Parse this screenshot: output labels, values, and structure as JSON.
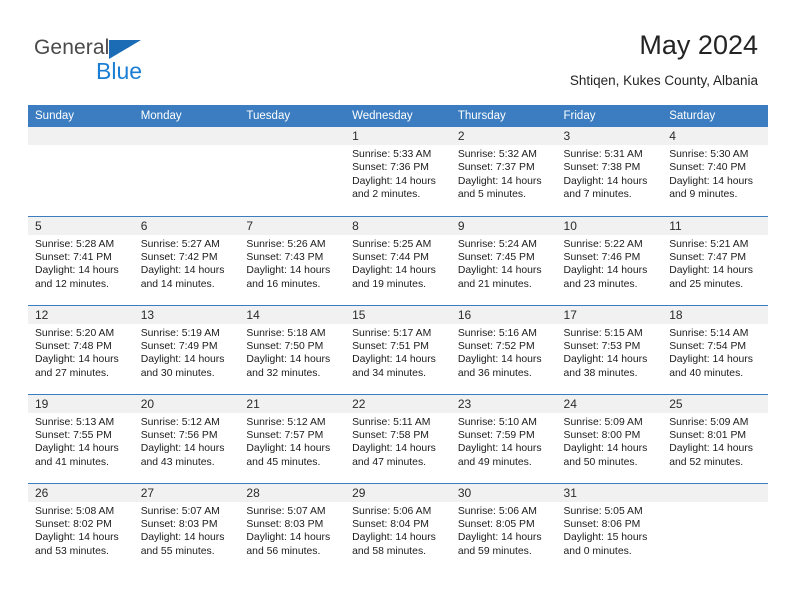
{
  "logo": {
    "word_top": "General",
    "word_bottom": "Blue",
    "color_dark": "#4a4a4a",
    "color_blue": "#1a7fd4",
    "triangle_color": "#1c6cb5"
  },
  "header": {
    "title": "May 2024",
    "subtitle": "Shtiqen, Kukes County, Albania",
    "accent_color": "#3b7dc0"
  },
  "calendar": {
    "weekdays": [
      "Sunday",
      "Monday",
      "Tuesday",
      "Wednesday",
      "Thursday",
      "Friday",
      "Saturday"
    ],
    "weeks": [
      [
        {
          "day": "",
          "empty": true
        },
        {
          "day": "",
          "empty": true
        },
        {
          "day": "",
          "empty": true
        },
        {
          "day": "1",
          "sunrise": "Sunrise: 5:33 AM",
          "sunset": "Sunset: 7:36 PM",
          "daylight_1": "Daylight: 14 hours",
          "daylight_2": "and 2 minutes."
        },
        {
          "day": "2",
          "sunrise": "Sunrise: 5:32 AM",
          "sunset": "Sunset: 7:37 PM",
          "daylight_1": "Daylight: 14 hours",
          "daylight_2": "and 5 minutes."
        },
        {
          "day": "3",
          "sunrise": "Sunrise: 5:31 AM",
          "sunset": "Sunset: 7:38 PM",
          "daylight_1": "Daylight: 14 hours",
          "daylight_2": "and 7 minutes."
        },
        {
          "day": "4",
          "sunrise": "Sunrise: 5:30 AM",
          "sunset": "Sunset: 7:40 PM",
          "daylight_1": "Daylight: 14 hours",
          "daylight_2": "and 9 minutes."
        }
      ],
      [
        {
          "day": "5",
          "sunrise": "Sunrise: 5:28 AM",
          "sunset": "Sunset: 7:41 PM",
          "daylight_1": "Daylight: 14 hours",
          "daylight_2": "and 12 minutes."
        },
        {
          "day": "6",
          "sunrise": "Sunrise: 5:27 AM",
          "sunset": "Sunset: 7:42 PM",
          "daylight_1": "Daylight: 14 hours",
          "daylight_2": "and 14 minutes."
        },
        {
          "day": "7",
          "sunrise": "Sunrise: 5:26 AM",
          "sunset": "Sunset: 7:43 PM",
          "daylight_1": "Daylight: 14 hours",
          "daylight_2": "and 16 minutes."
        },
        {
          "day": "8",
          "sunrise": "Sunrise: 5:25 AM",
          "sunset": "Sunset: 7:44 PM",
          "daylight_1": "Daylight: 14 hours",
          "daylight_2": "and 19 minutes."
        },
        {
          "day": "9",
          "sunrise": "Sunrise: 5:24 AM",
          "sunset": "Sunset: 7:45 PM",
          "daylight_1": "Daylight: 14 hours",
          "daylight_2": "and 21 minutes."
        },
        {
          "day": "10",
          "sunrise": "Sunrise: 5:22 AM",
          "sunset": "Sunset: 7:46 PM",
          "daylight_1": "Daylight: 14 hours",
          "daylight_2": "and 23 minutes."
        },
        {
          "day": "11",
          "sunrise": "Sunrise: 5:21 AM",
          "sunset": "Sunset: 7:47 PM",
          "daylight_1": "Daylight: 14 hours",
          "daylight_2": "and 25 minutes."
        }
      ],
      [
        {
          "day": "12",
          "sunrise": "Sunrise: 5:20 AM",
          "sunset": "Sunset: 7:48 PM",
          "daylight_1": "Daylight: 14 hours",
          "daylight_2": "and 27 minutes."
        },
        {
          "day": "13",
          "sunrise": "Sunrise: 5:19 AM",
          "sunset": "Sunset: 7:49 PM",
          "daylight_1": "Daylight: 14 hours",
          "daylight_2": "and 30 minutes."
        },
        {
          "day": "14",
          "sunrise": "Sunrise: 5:18 AM",
          "sunset": "Sunset: 7:50 PM",
          "daylight_1": "Daylight: 14 hours",
          "daylight_2": "and 32 minutes."
        },
        {
          "day": "15",
          "sunrise": "Sunrise: 5:17 AM",
          "sunset": "Sunset: 7:51 PM",
          "daylight_1": "Daylight: 14 hours",
          "daylight_2": "and 34 minutes."
        },
        {
          "day": "16",
          "sunrise": "Sunrise: 5:16 AM",
          "sunset": "Sunset: 7:52 PM",
          "daylight_1": "Daylight: 14 hours",
          "daylight_2": "and 36 minutes."
        },
        {
          "day": "17",
          "sunrise": "Sunrise: 5:15 AM",
          "sunset": "Sunset: 7:53 PM",
          "daylight_1": "Daylight: 14 hours",
          "daylight_2": "and 38 minutes."
        },
        {
          "day": "18",
          "sunrise": "Sunrise: 5:14 AM",
          "sunset": "Sunset: 7:54 PM",
          "daylight_1": "Daylight: 14 hours",
          "daylight_2": "and 40 minutes."
        }
      ],
      [
        {
          "day": "19",
          "sunrise": "Sunrise: 5:13 AM",
          "sunset": "Sunset: 7:55 PM",
          "daylight_1": "Daylight: 14 hours",
          "daylight_2": "and 41 minutes."
        },
        {
          "day": "20",
          "sunrise": "Sunrise: 5:12 AM",
          "sunset": "Sunset: 7:56 PM",
          "daylight_1": "Daylight: 14 hours",
          "daylight_2": "and 43 minutes."
        },
        {
          "day": "21",
          "sunrise": "Sunrise: 5:12 AM",
          "sunset": "Sunset: 7:57 PM",
          "daylight_1": "Daylight: 14 hours",
          "daylight_2": "and 45 minutes."
        },
        {
          "day": "22",
          "sunrise": "Sunrise: 5:11 AM",
          "sunset": "Sunset: 7:58 PM",
          "daylight_1": "Daylight: 14 hours",
          "daylight_2": "and 47 minutes."
        },
        {
          "day": "23",
          "sunrise": "Sunrise: 5:10 AM",
          "sunset": "Sunset: 7:59 PM",
          "daylight_1": "Daylight: 14 hours",
          "daylight_2": "and 49 minutes."
        },
        {
          "day": "24",
          "sunrise": "Sunrise: 5:09 AM",
          "sunset": "Sunset: 8:00 PM",
          "daylight_1": "Daylight: 14 hours",
          "daylight_2": "and 50 minutes."
        },
        {
          "day": "25",
          "sunrise": "Sunrise: 5:09 AM",
          "sunset": "Sunset: 8:01 PM",
          "daylight_1": "Daylight: 14 hours",
          "daylight_2": "and 52 minutes."
        }
      ],
      [
        {
          "day": "26",
          "sunrise": "Sunrise: 5:08 AM",
          "sunset": "Sunset: 8:02 PM",
          "daylight_1": "Daylight: 14 hours",
          "daylight_2": "and 53 minutes."
        },
        {
          "day": "27",
          "sunrise": "Sunrise: 5:07 AM",
          "sunset": "Sunset: 8:03 PM",
          "daylight_1": "Daylight: 14 hours",
          "daylight_2": "and 55 minutes."
        },
        {
          "day": "28",
          "sunrise": "Sunrise: 5:07 AM",
          "sunset": "Sunset: 8:03 PM",
          "daylight_1": "Daylight: 14 hours",
          "daylight_2": "and 56 minutes."
        },
        {
          "day": "29",
          "sunrise": "Sunrise: 5:06 AM",
          "sunset": "Sunset: 8:04 PM",
          "daylight_1": "Daylight: 14 hours",
          "daylight_2": "and 58 minutes."
        },
        {
          "day": "30",
          "sunrise": "Sunrise: 5:06 AM",
          "sunset": "Sunset: 8:05 PM",
          "daylight_1": "Daylight: 14 hours",
          "daylight_2": "and 59 minutes."
        },
        {
          "day": "31",
          "sunrise": "Sunrise: 5:05 AM",
          "sunset": "Sunset: 8:06 PM",
          "daylight_1": "Daylight: 15 hours",
          "daylight_2": "and 0 minutes."
        }
      ]
    ]
  }
}
